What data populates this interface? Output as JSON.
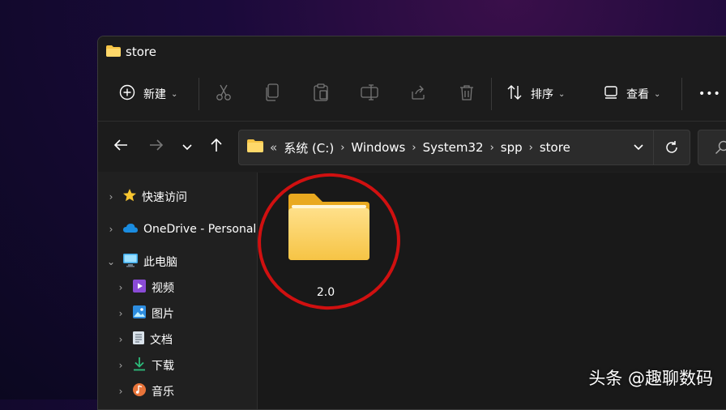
{
  "window": {
    "title": "store"
  },
  "toolbar": {
    "new_label": "新建",
    "sort_label": "排序",
    "view_label": "查看",
    "more_label": "•••"
  },
  "address": {
    "prefix": "«",
    "crumbs": [
      "系统 (C:)",
      "Windows",
      "System32",
      "spp",
      "store"
    ]
  },
  "sidebar": {
    "items": [
      {
        "label": "快速访问"
      },
      {
        "label": "OneDrive - Personal"
      },
      {
        "label": "此电脑"
      },
      {
        "label": "视频"
      },
      {
        "label": "图片"
      },
      {
        "label": "文档"
      },
      {
        "label": "下载"
      },
      {
        "label": "音乐"
      }
    ]
  },
  "content": {
    "folders": [
      {
        "name": "2.0"
      }
    ]
  },
  "watermark": {
    "text": "头条 @趣聊数码"
  },
  "colors": {
    "annotation_ring": "#d01010",
    "folder": "#f6c445"
  }
}
